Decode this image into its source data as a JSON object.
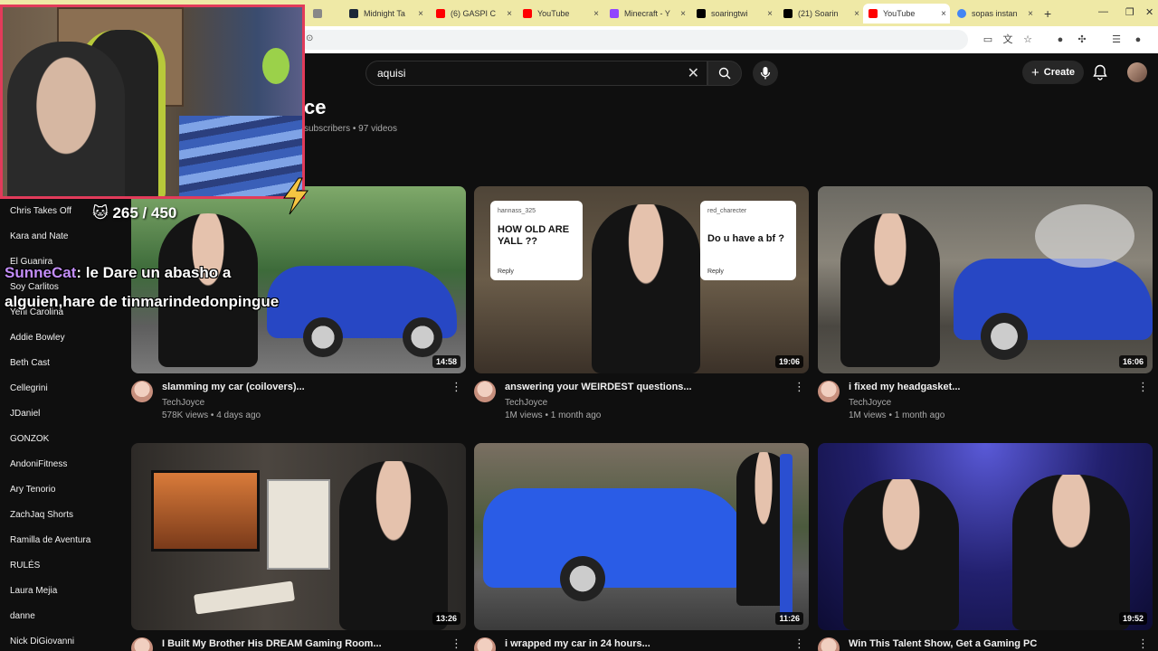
{
  "browser": {
    "tabs": [
      {
        "label": "Midnight Ta",
        "color": "#1b2838"
      },
      {
        "label": "(6) GASPI C",
        "color": "#ff0000"
      },
      {
        "label": "YouTube",
        "color": "#ff0000"
      },
      {
        "label": "Minecraft - Y",
        "color": "#9146ff"
      },
      {
        "label": "soaringtwi",
        "color": "#000000"
      },
      {
        "label": "(21) Soarin",
        "color": "#000000"
      },
      {
        "label": "YouTube",
        "color": "#ff0000",
        "active": true
      },
      {
        "label": "sopas instan",
        "color": "#4285f4"
      }
    ],
    "new_tab": "+",
    "tab_close": "×"
  },
  "header": {
    "search_value": "aquisi",
    "create_label": "Create"
  },
  "channel": {
    "name_partial": "ce",
    "meta": "subscribers • 97 videos"
  },
  "sidebar": {
    "items": [
      "Chris Takes Off",
      "Kara and Nate",
      "El Guanira",
      "Soy Carlitos",
      "Yeni Carolina",
      "Addie Bowley",
      "Beth Cast",
      "Cellegrini",
      "JDaniel",
      "GONZOK",
      "AndoniFitness",
      "Ary Tenorio",
      "ZachJaq Shorts",
      "Ramilla de Aventura",
      "RULÉS",
      "Laura Mejia",
      "danne",
      "Nick DiGiovanni"
    ]
  },
  "stream_overlay": {
    "counter": "265 / 450",
    "chat_user": "SunneCat",
    "chat_text": ": le Dare un abasho a alguien,hare de tinmarindedonpingue"
  },
  "videos": [
    {
      "title": "slamming my car (coilovers)...",
      "channel": "TechJoyce",
      "meta": "578K views • 4 days ago",
      "duration": "14:58"
    },
    {
      "title": "answering your WEIRDEST questions...",
      "channel": "TechJoyce",
      "meta": "1M views • 1 month ago",
      "duration": "19:06",
      "cards": [
        {
          "user": "hannass_325",
          "question": "HOW OLD ARE YALL ??",
          "reply": "Reply"
        },
        {
          "user": "red_charecter",
          "question": "Do u have a bf ?",
          "reply": "Reply"
        }
      ]
    },
    {
      "title": "i fixed my headgasket...",
      "channel": "TechJoyce",
      "meta": "1M views • 1 month ago",
      "duration": "16:06"
    },
    {
      "title": "I Built My Brother His DREAM Gaming Room...",
      "duration": "13:26"
    },
    {
      "title": "i wrapped my car in 24 hours...",
      "duration": "11:26"
    },
    {
      "title": "Win This Talent Show, Get a Gaming PC",
      "duration": "19:52"
    }
  ],
  "colors": {
    "background": "#0f0f0f",
    "webcam_border": "#e23b5a",
    "chat_user": "#c28df7",
    "car_blue": "#2747c4"
  }
}
